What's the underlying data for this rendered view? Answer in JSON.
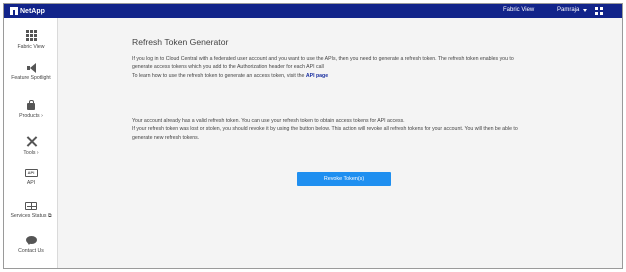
{
  "header": {
    "logo_text": "NetApp",
    "fabric_view": "Fabric View",
    "user_name": "Pamraja",
    "colors": {
      "bar": "#12248a",
      "text": "#ffffff"
    }
  },
  "sidebar": {
    "items": [
      {
        "label": "Fabric View",
        "icon": "grid-icon"
      },
      {
        "label": "Feature Spotlight",
        "icon": "megaphone-icon"
      },
      {
        "label": "Products",
        "suffix": "›",
        "icon": "shopping-bag-icon"
      },
      {
        "label": "Tools",
        "suffix": "›",
        "icon": "tools-icon"
      },
      {
        "label": "API",
        "icon": "api-icon"
      },
      {
        "label": "Services Status",
        "suffix": "⧉",
        "icon": "pulse-icon"
      },
      {
        "label": "Contact Us",
        "icon": "chat-icon"
      }
    ],
    "api_icon_text": "API"
  },
  "main": {
    "title": "Refresh Token Generator",
    "para1": {
      "line1": "If you log in to Cloud Central with a federated user account and you want to use the APIs, then you need to generate a refresh token. The refresh token enables you to",
      "line2": "generate access tokens which you add to the Authorization header for each API call",
      "line3_prefix": "To learn how to use the refresh token to generate an access token, visit the",
      "line3_link": "API page"
    },
    "para2": {
      "line1": "Your account already has a valid refresh token. You can use your refresh token to obtain access tokens for API access.",
      "line2": "If your refresh token was lost or stolen, you should revoke it by using the button below. This action will revoke all refresh tokens for your account. You will then be able to",
      "line3": "generate new refresh tokens."
    },
    "revoke_button": "Revoke Token(s)",
    "colors": {
      "button": "#1f8ff0",
      "link": "#1a2fa0",
      "background": "#f4f4f4"
    }
  }
}
